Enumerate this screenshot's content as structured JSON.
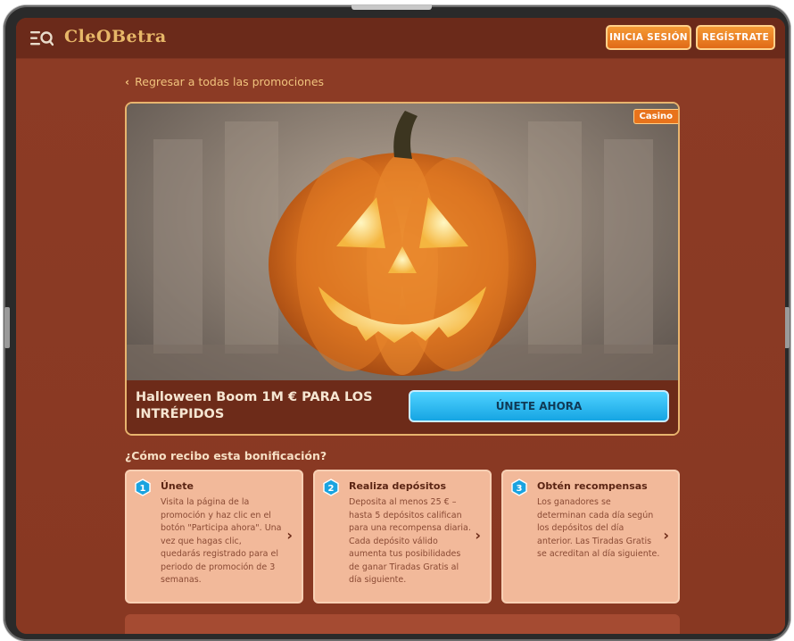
{
  "header": {
    "logo": "CleOBetra",
    "login_label": "INICIA SESIÓN",
    "register_label": "REGÍSTRATE"
  },
  "nav": {
    "back_label": "Regresar a todas las promociones"
  },
  "promo": {
    "tag": "Casino",
    "title": "Halloween Boom 1M € PARA LOS INTRÉPIDOS",
    "cta_label": "ÚNETE AHORA"
  },
  "how": {
    "title": "¿Cómo recibo esta bonificación?",
    "steps": [
      {
        "number": "1",
        "title": "Únete",
        "desc": "Visita la página de la promoción y haz clic en el botón \"Participa ahora\". Una vez que hagas clic, quedarás registrado para el periodo de promoción de 3 semanas."
      },
      {
        "number": "2",
        "title": "Realiza depósitos",
        "desc": "Deposita al menos 25 € – hasta 5 depósitos califican para una recompensa diaria. Cada depósito válido aumenta tus posibilidades de ganar Tiradas Gratis al día siguiente."
      },
      {
        "number": "3",
        "title": "Obtén recompensas",
        "desc": "Los ganadores se determinan cada día según los depósitos del día anterior. Las Tiradas Gratis se acreditan al día siguiente."
      }
    ]
  },
  "colors": {
    "background": "#8a3a25",
    "header": "#6b2a1a",
    "accent_orange": "#e8731c",
    "cta_blue": "#16a5e3",
    "card": "#f2b99a",
    "gold": "#e8b46e"
  },
  "icons": [
    "menu-search-icon",
    "back-chevron-icon",
    "step-number-badge-icon",
    "step-arrow-icon"
  ]
}
